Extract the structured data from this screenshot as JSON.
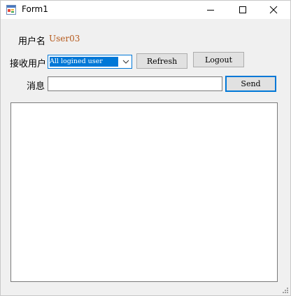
{
  "window": {
    "title": "Form1",
    "icons": {
      "app": "form-app-icon",
      "minimize": "minimize-icon",
      "maximize": "maximize-icon",
      "close": "close-icon"
    }
  },
  "form": {
    "username_label": "用户名",
    "username_value": "User03",
    "receiver_label": "接收用户",
    "receiver_selected": "All logined user",
    "refresh_label": "Refresh",
    "logout_label": "Logout",
    "message_label": "消息",
    "message_value": "",
    "send_label": "Send",
    "log_text": ""
  },
  "colors": {
    "accent": "#0078d7",
    "username_text": "#b5581a",
    "background": "#f0f0f0"
  }
}
